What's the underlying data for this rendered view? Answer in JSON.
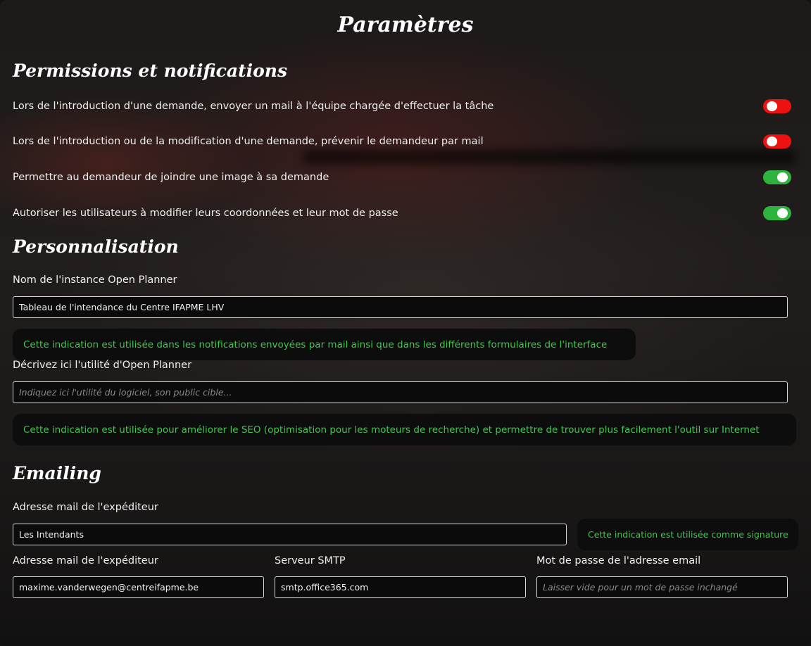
{
  "title": "Paramètres",
  "sections": {
    "permissions": {
      "heading": "Permissions et notifications",
      "items": [
        {
          "label": "Lors de l'introduction d'une demande, envoyer un mail à l'équipe chargée d'effectuer la tâche",
          "enabled": false
        },
        {
          "label": "Lors de l'introduction ou de la modification d'une demande, prévenir le demandeur par mail",
          "enabled": false
        },
        {
          "label": "Permettre au demandeur de joindre une image à sa demande",
          "enabled": true
        },
        {
          "label": "Autoriser les utilisateurs à modifier leurs coordonnées et leur mot de passe",
          "enabled": true
        }
      ]
    },
    "personnalisation": {
      "heading": "Personnalisation",
      "instance_name": {
        "label": "Nom de l'instance Open Planner",
        "value": "Tableau de l'intendance du Centre IFAPME LHV",
        "hint": "Cette indication est utilisée dans les notifications envoyées par mail ainsi que dans les différents formulaires de l'interface"
      },
      "description": {
        "label": "Décrivez ici l'utilité d'Open Planner",
        "value": "",
        "placeholder": "Indiquez ici l'utilité du logiciel, son public cible...",
        "hint": "Cette indication est utilisée pour améliorer le SEO (optimisation pour les moteurs de recherche) et permettre de trouver plus facilement l'outil sur Internet"
      }
    },
    "emailing": {
      "heading": "Emailing",
      "sender_name": {
        "label": "Adresse mail de l'expéditeur",
        "value": "Les Intendants",
        "hint": "Cette indication est utilisée comme signature"
      },
      "sender_address": {
        "label": "Adresse mail de l'expéditeur",
        "value": "maxime.vanderwegen@centreifapme.be"
      },
      "smtp_server": {
        "label": "Serveur SMTP",
        "value": "smtp.office365.com"
      },
      "password": {
        "label": "Mot de passe de l'adresse email",
        "value": "",
        "placeholder": "Laisser vide pour un mot de passe inchangé"
      }
    }
  },
  "colors": {
    "toggle_off": "#ee1111",
    "toggle_on": "#2fb33f",
    "hint_text": "#45c450"
  }
}
